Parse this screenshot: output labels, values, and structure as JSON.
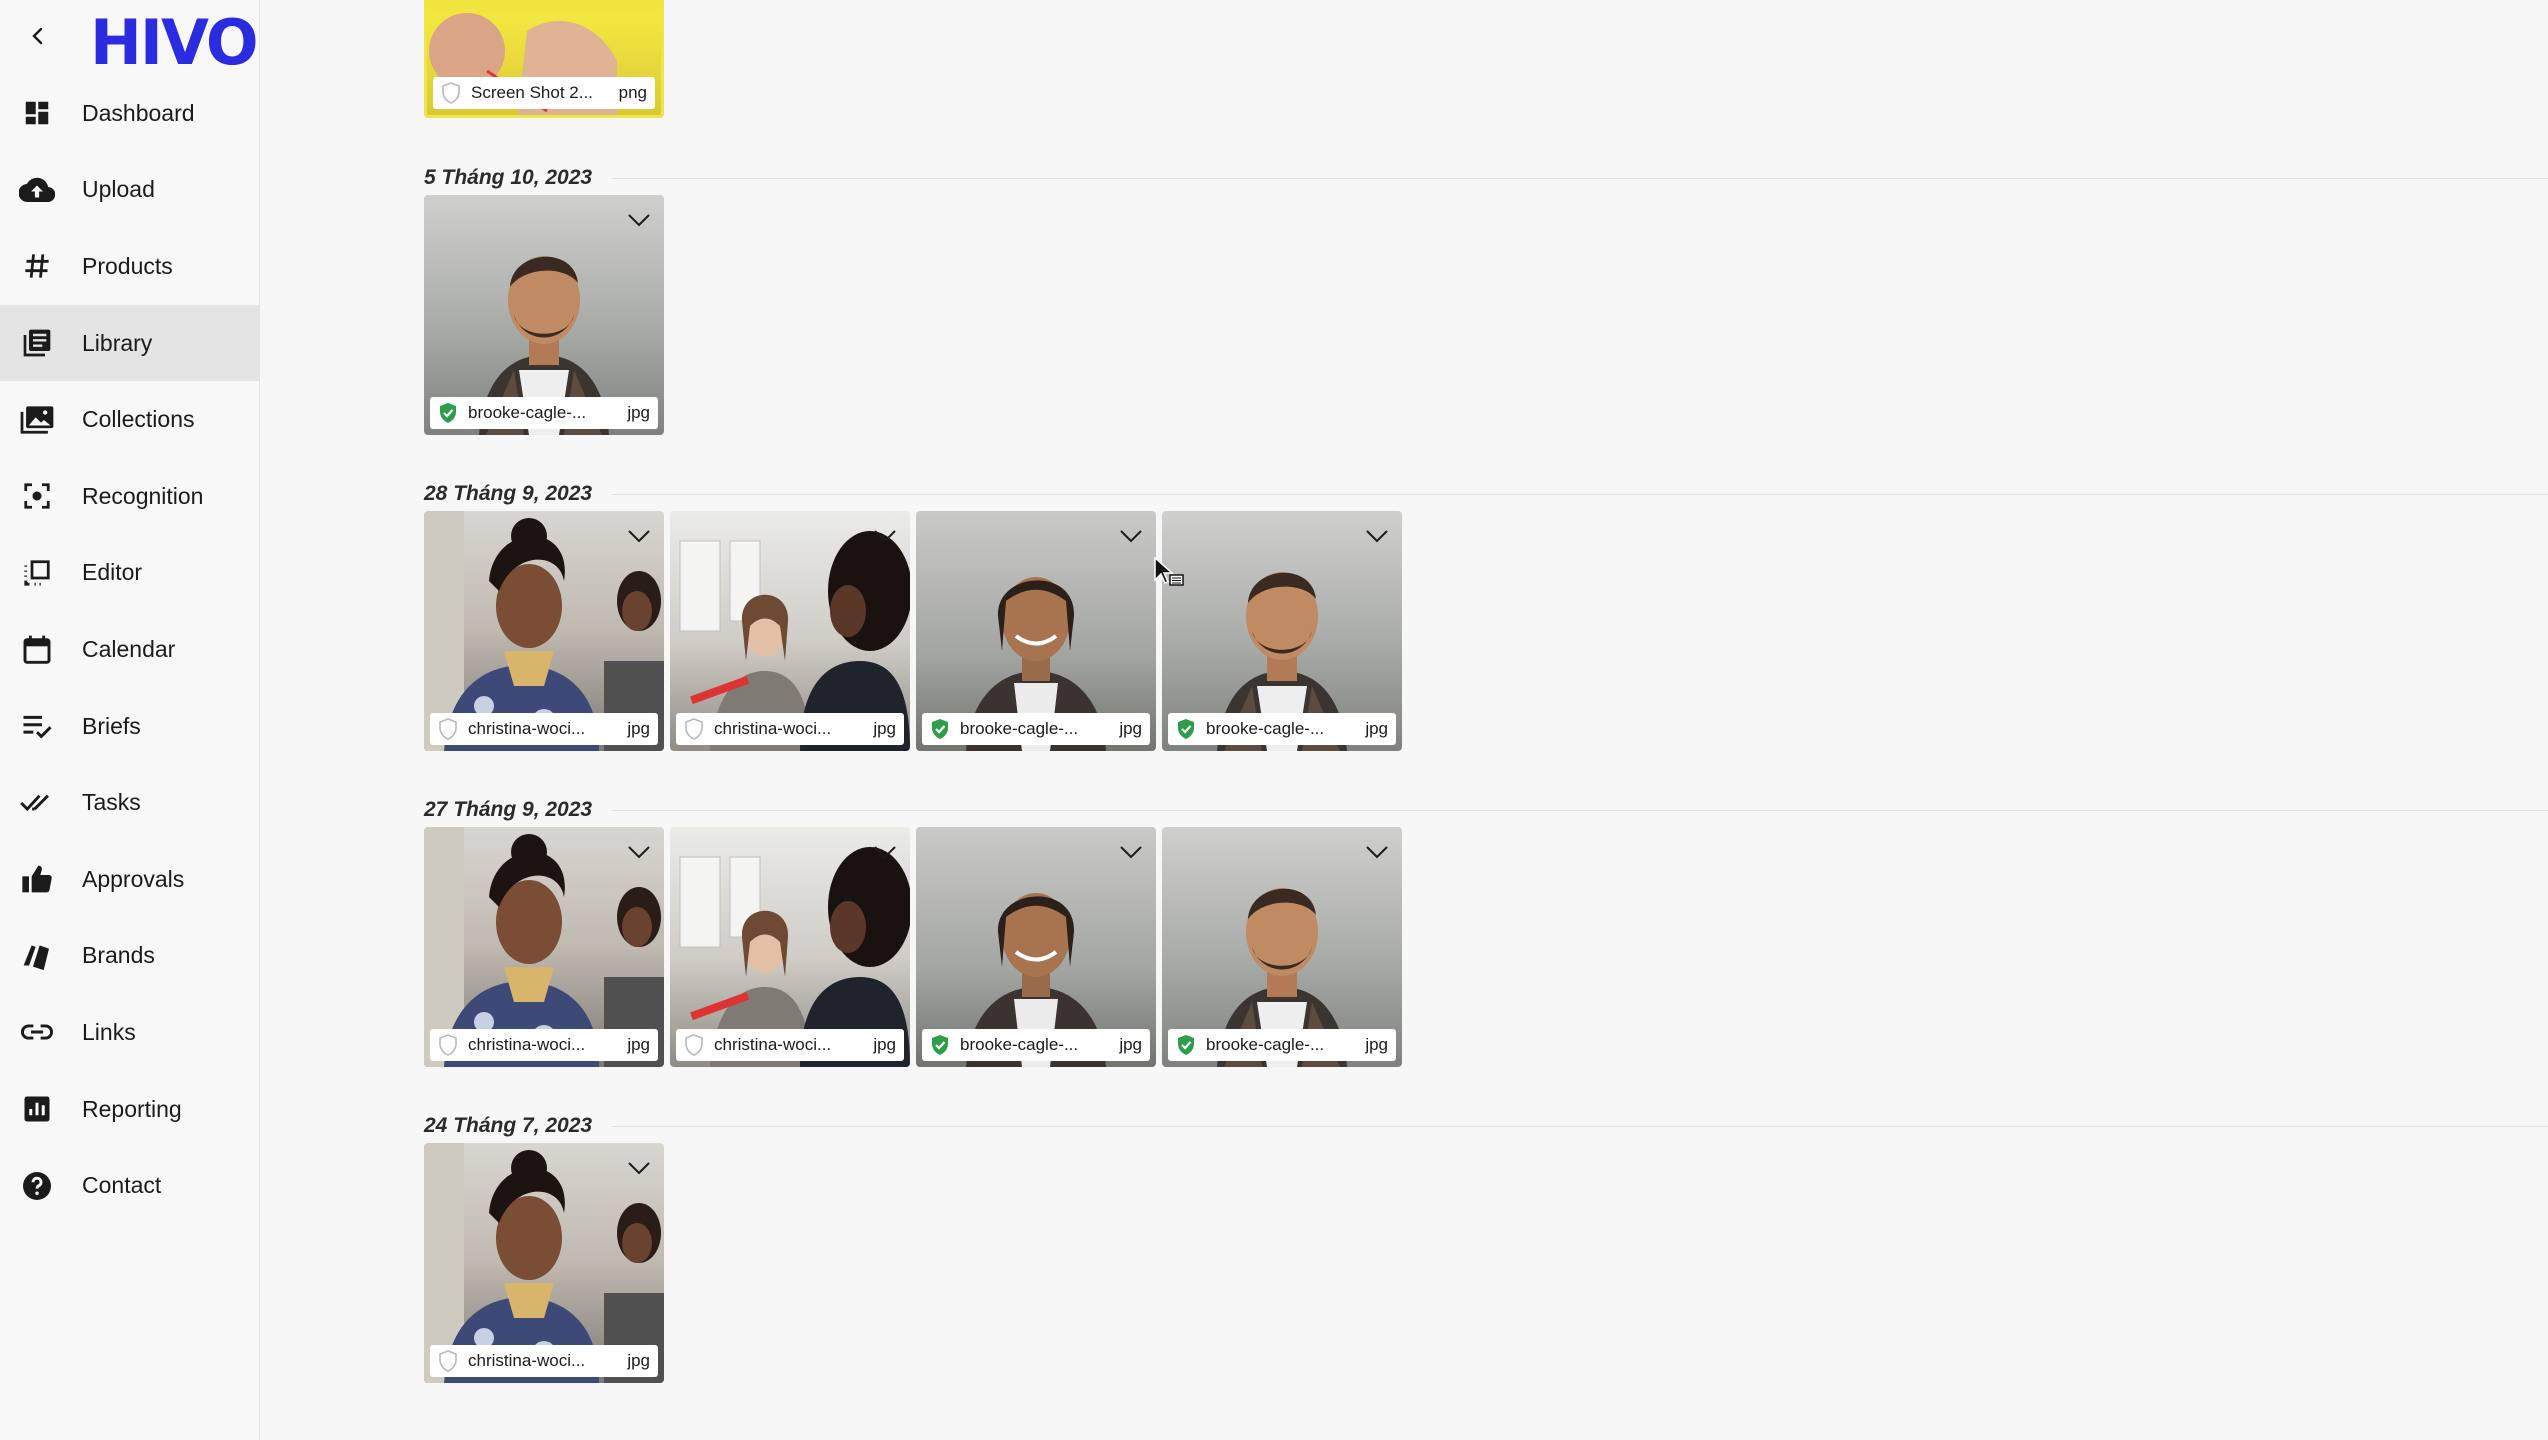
{
  "app": {
    "logo": "HIVO"
  },
  "sidebar": {
    "items": [
      {
        "label": "Dashboard",
        "icon": "dashboard-icon"
      },
      {
        "label": "Upload",
        "icon": "cloud-upload-icon"
      },
      {
        "label": "Products",
        "icon": "hash-icon"
      },
      {
        "label": "Library",
        "icon": "library-icon",
        "active": true
      },
      {
        "label": "Collections",
        "icon": "collections-icon"
      },
      {
        "label": "Recognition",
        "icon": "recognition-icon"
      },
      {
        "label": "Editor",
        "icon": "editor-icon"
      },
      {
        "label": "Calendar",
        "icon": "calendar-icon"
      },
      {
        "label": "Briefs",
        "icon": "briefs-icon"
      },
      {
        "label": "Tasks",
        "icon": "tasks-icon"
      },
      {
        "label": "Approvals",
        "icon": "thumbs-up-icon"
      },
      {
        "label": "Brands",
        "icon": "brands-icon"
      },
      {
        "label": "Links",
        "icon": "link-icon"
      },
      {
        "label": "Reporting",
        "icon": "reporting-icon"
      },
      {
        "label": "Contact",
        "icon": "help-icon"
      }
    ]
  },
  "library": {
    "top_partial": {
      "name": "Screen Shot 2...",
      "ext": "png",
      "approved": false
    },
    "groups": [
      {
        "date": "5 Tháng 10, 2023",
        "files": [
          {
            "name": "brooke-cagle-...",
            "ext": "jpg",
            "approved": true,
            "photo": "man"
          }
        ]
      },
      {
        "date": "28 Tháng 9, 2023",
        "files": [
          {
            "name": "christina-woci...",
            "ext": "jpg",
            "approved": false,
            "photo": "woman"
          },
          {
            "name": "christina-woci...",
            "ext": "jpg",
            "approved": false,
            "photo": "office"
          },
          {
            "name": "brooke-cagle-...",
            "ext": "jpg",
            "approved": true,
            "photo": "man2"
          },
          {
            "name": "brooke-cagle-...",
            "ext": "jpg",
            "approved": true,
            "photo": "man"
          }
        ]
      },
      {
        "date": "27 Tháng 9, 2023",
        "files": [
          {
            "name": "christina-woci...",
            "ext": "jpg",
            "approved": false,
            "photo": "woman"
          },
          {
            "name": "christina-woci...",
            "ext": "jpg",
            "approved": false,
            "photo": "office"
          },
          {
            "name": "brooke-cagle-...",
            "ext": "jpg",
            "approved": true,
            "photo": "man2"
          },
          {
            "name": "brooke-cagle-...",
            "ext": "jpg",
            "approved": true,
            "photo": "man"
          }
        ]
      },
      {
        "date": "24 Tháng 7, 2023",
        "files": [
          {
            "name": "christina-woci...",
            "ext": "jpg",
            "approved": false,
            "photo": "woman"
          }
        ]
      }
    ]
  },
  "colors": {
    "brand": "#2b2bdf",
    "approved": "#2e9e4a",
    "active_nav": "#e4e4e4"
  }
}
